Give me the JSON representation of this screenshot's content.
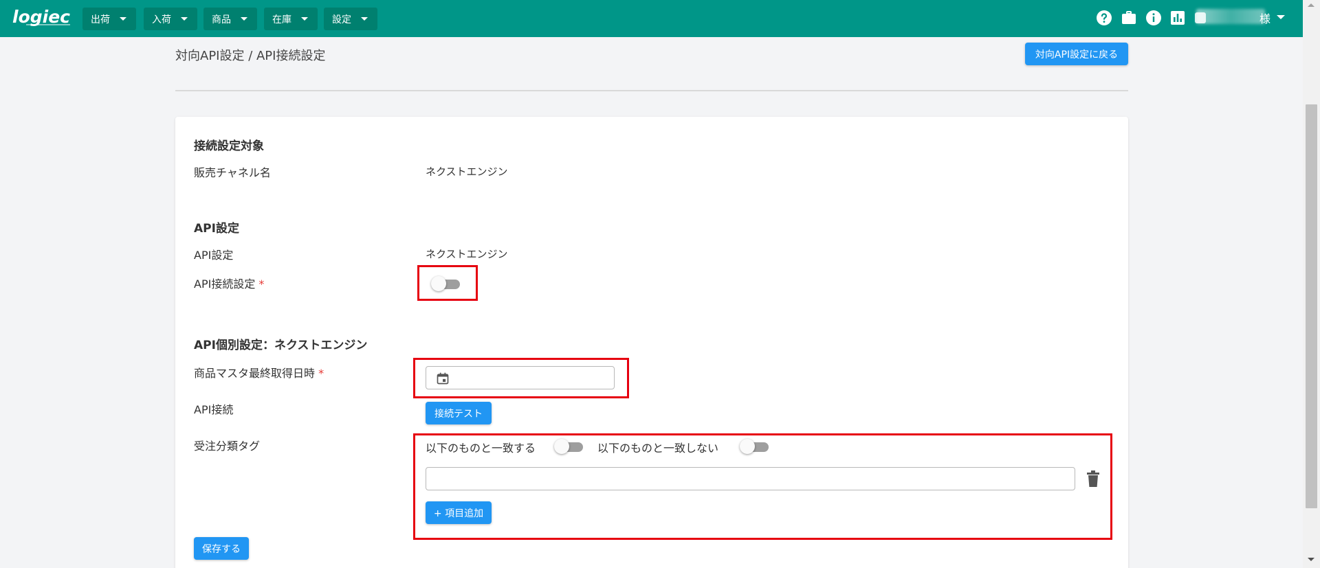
{
  "app": {
    "logo": "logiec"
  },
  "nav": {
    "items": [
      {
        "label": "出荷"
      },
      {
        "label": "入荷"
      },
      {
        "label": "商品"
      },
      {
        "label": "在庫"
      },
      {
        "label": "設定"
      }
    ]
  },
  "topbar_icons": [
    "help-icon",
    "briefcase-icon",
    "info-icon",
    "chart-icon",
    "notification-icon"
  ],
  "user": {
    "suffix": "様"
  },
  "header": {
    "breadcrumb": "対向API設定 / API接続設定",
    "back_button": "対向API設定に戻る"
  },
  "sections": {
    "target": {
      "title": "接続設定対象",
      "channel_label": "販売チャネル名",
      "channel_value": "ネクストエンジン"
    },
    "api": {
      "title": "API設定",
      "api_label": "API設定",
      "api_value": "ネクストエンジン",
      "connect_label": "API接続設定",
      "required_mark": "*",
      "connect_enabled": false
    },
    "individual": {
      "title": "API個別設定：ネクストエンジン",
      "product_master_label": "商品マスタ最終取得日時",
      "required_mark": "*",
      "product_master_value": "",
      "api_connect_label": "API接続",
      "test_button": "接続テスト",
      "order_tag_label": "受注分類タグ",
      "match_label": "以下のものと一致する",
      "match_enabled": false,
      "not_match_label": "以下のものと一致しない",
      "not_match_enabled": false,
      "tag_value": "",
      "add_button": "+ 項目追加"
    }
  },
  "save_button": "保存する",
  "colors": {
    "topbar": "#009688",
    "primary_button": "#2196f3",
    "highlight_border": "#e6000f",
    "required": "#e53935"
  }
}
